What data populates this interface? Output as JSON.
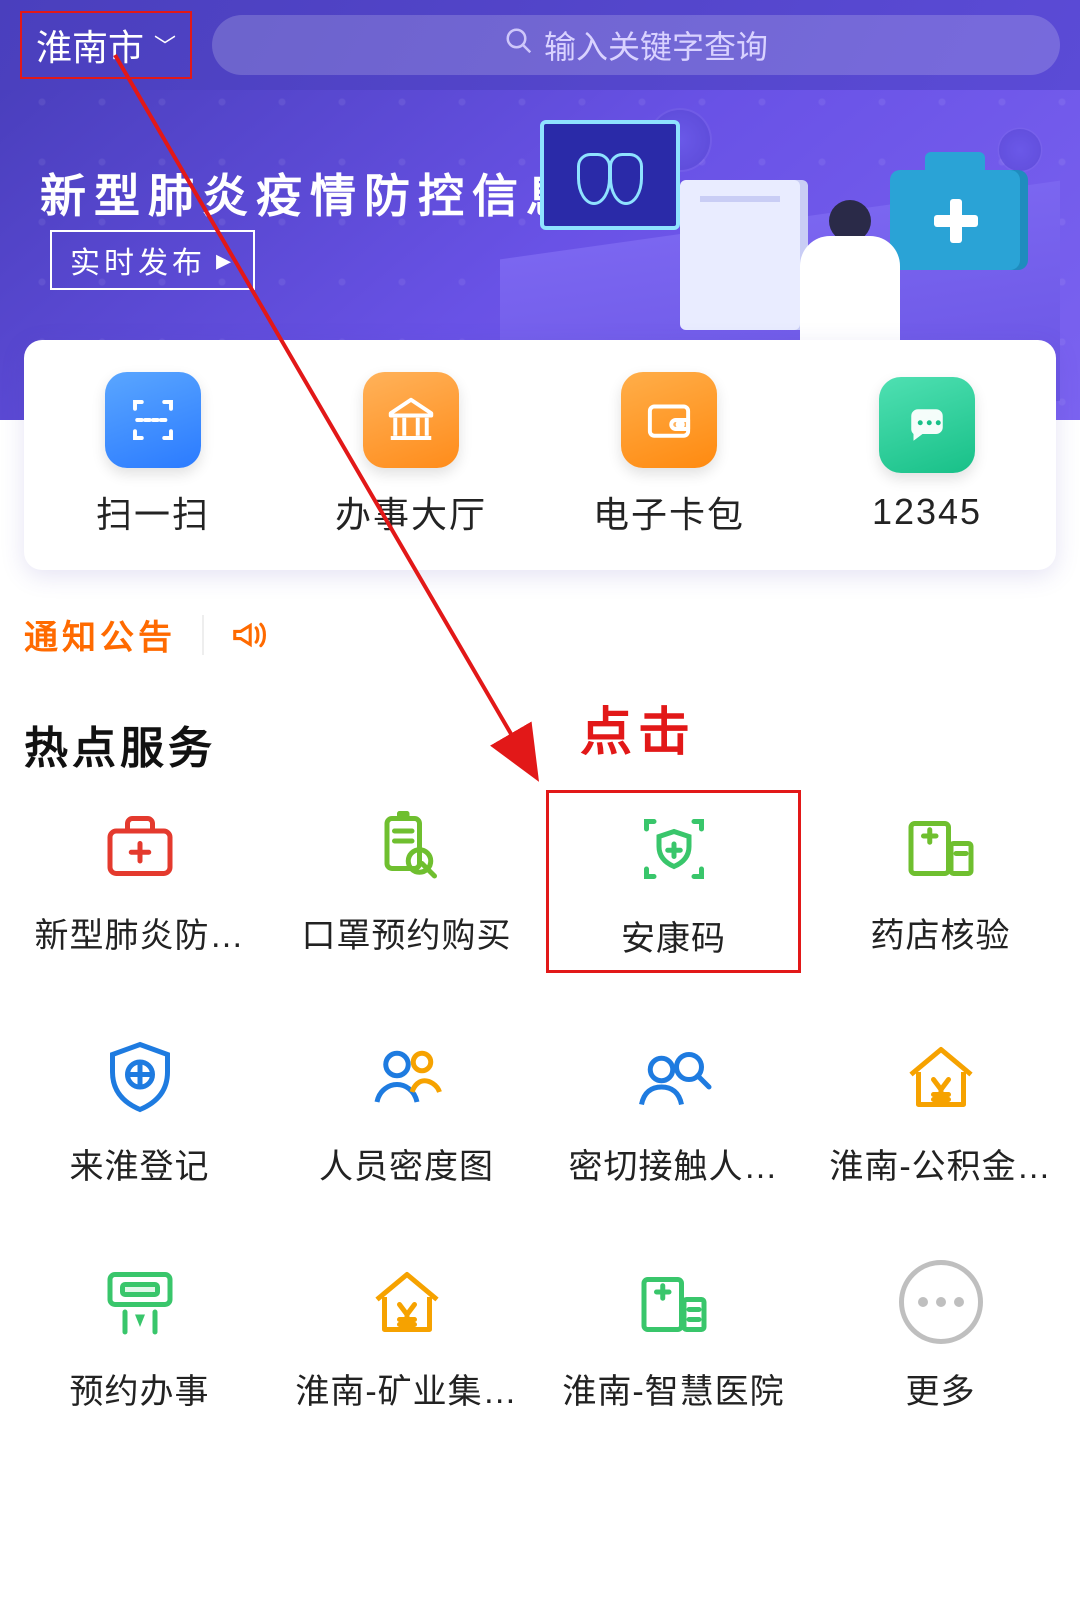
{
  "header": {
    "city": "淮南市",
    "search_placeholder": "输入关键字查询"
  },
  "banner": {
    "title": "新型肺炎疫情防控信息",
    "button": "实时发布"
  },
  "quick": [
    {
      "label": "扫一扫",
      "icon": "scan-icon"
    },
    {
      "label": "办事大厅",
      "icon": "hall-icon"
    },
    {
      "label": "电子卡包",
      "icon": "wallet-icon"
    },
    {
      "label": "12345",
      "icon": "chat-icon"
    }
  ],
  "notice": {
    "label": "通知公告"
  },
  "section": {
    "hot_title": "热点服务"
  },
  "services": [
    {
      "label": "新型肺炎防…",
      "icon": "medkit-icon",
      "color": "#e43a2e",
      "highlight": false
    },
    {
      "label": "口罩预约购买",
      "icon": "mask-icon",
      "color": "#6fbf2f",
      "highlight": false
    },
    {
      "label": "安康码",
      "icon": "shield-scan-icon",
      "color": "#39c66b",
      "highlight": true
    },
    {
      "label": "药店核验",
      "icon": "pharmacy-icon",
      "color": "#6fbf2f",
      "highlight": false
    },
    {
      "label": "来淮登记",
      "icon": "target-icon",
      "color": "#1e7be0",
      "highlight": false
    },
    {
      "label": "人员密度图",
      "icon": "people-icon",
      "color": "#1e7be0",
      "highlight": false
    },
    {
      "label": "密切接触人…",
      "icon": "contact-search-icon",
      "color": "#1e7be0",
      "highlight": false
    },
    {
      "label": "淮南-公积金…",
      "icon": "fund-house-icon",
      "color": "#f6a200",
      "highlight": false
    },
    {
      "label": "预约办事",
      "icon": "atm-icon",
      "color": "#39c66b",
      "highlight": false
    },
    {
      "label": "淮南-矿业集…",
      "icon": "yen-house-icon",
      "color": "#f6a200",
      "highlight": false
    },
    {
      "label": "淮南-智慧医院",
      "icon": "hospital-icon",
      "color": "#39c66b",
      "highlight": false
    },
    {
      "label": "更多",
      "icon": "more-icon",
      "color": "#bfbfbf",
      "highlight": false
    }
  ],
  "annotation": {
    "click_label": "点击"
  }
}
